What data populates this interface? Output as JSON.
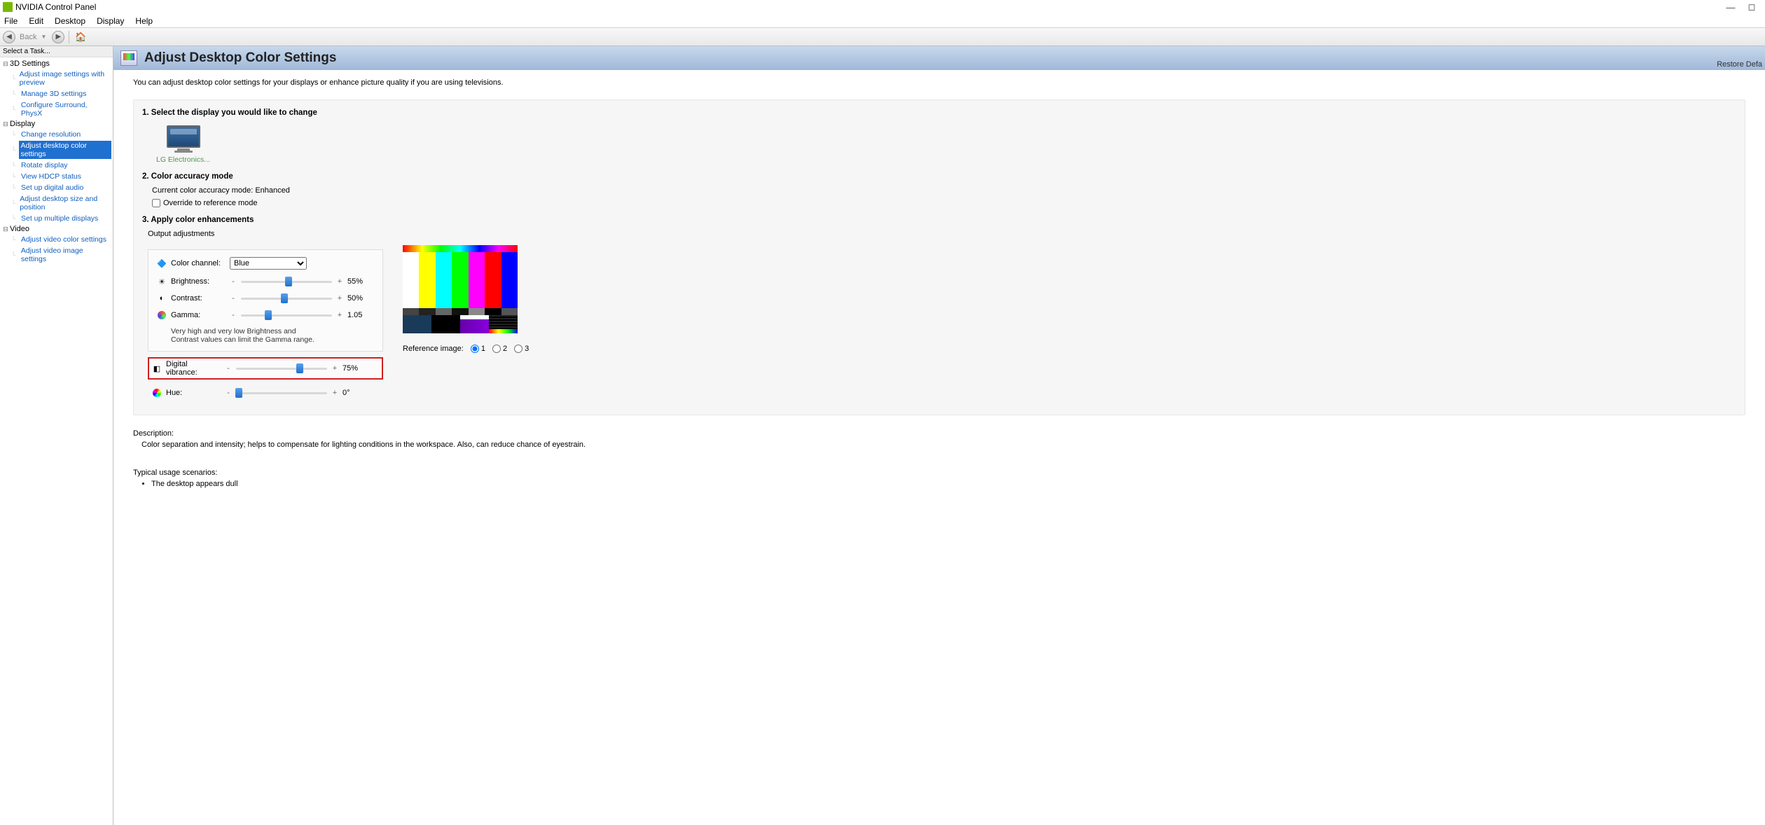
{
  "window": {
    "title": "NVIDIA Control Panel"
  },
  "menu": {
    "file": "File",
    "edit": "Edit",
    "desktop": "Desktop",
    "display": "Display",
    "help": "Help"
  },
  "toolbar": {
    "back": "Back"
  },
  "sidebar": {
    "header": "Select a Task...",
    "groups": [
      {
        "label": "3D Settings",
        "items": [
          {
            "label": "Adjust image settings with preview"
          },
          {
            "label": "Manage 3D settings"
          },
          {
            "label": "Configure Surround, PhysX"
          }
        ]
      },
      {
        "label": "Display",
        "items": [
          {
            "label": "Change resolution"
          },
          {
            "label": "Adjust desktop color settings",
            "selected": true
          },
          {
            "label": "Rotate display"
          },
          {
            "label": "View HDCP status"
          },
          {
            "label": "Set up digital audio"
          },
          {
            "label": "Adjust desktop size and position"
          },
          {
            "label": "Set up multiple displays"
          }
        ]
      },
      {
        "label": "Video",
        "items": [
          {
            "label": "Adjust video color settings"
          },
          {
            "label": "Adjust video image settings"
          }
        ]
      }
    ]
  },
  "page": {
    "title": "Adjust Desktop Color Settings",
    "restore": "Restore Defa",
    "intro": "You can adjust desktop color settings for your displays or enhance picture quality if you are using televisions.",
    "step1": "1. Select the display you would like to change",
    "monitor": "LG Electronics...",
    "step2": "2. Color accuracy mode",
    "accuracy_current": "Current color accuracy mode: Enhanced",
    "accuracy_override": "Override to reference mode",
    "step3": "3. Apply color enhancements",
    "output_adj": "Output adjustments",
    "color_channel_label": "Color channel:",
    "color_channel_value": "Blue",
    "brightness": {
      "label": "Brightness:",
      "value": "55%",
      "pct": 52
    },
    "contrast": {
      "label": "Contrast:",
      "value": "50%",
      "pct": 48
    },
    "gamma": {
      "label": "Gamma:",
      "value": "1.05",
      "pct": 30
    },
    "note": "Very high and very low Brightness and Contrast values can limit the Gamma range.",
    "vibrance": {
      "label": "Digital vibrance:",
      "value": "75%",
      "pct": 70
    },
    "hue": {
      "label": "Hue:",
      "value": "0°",
      "pct": 3
    },
    "refimg_label": "Reference image:",
    "ref": {
      "r1": "1",
      "r2": "2",
      "r3": "3"
    },
    "desc_hdr": "Description:",
    "desc_txt": "Color separation and intensity; helps to compensate for lighting conditions in the workspace. Also, can reduce chance of eyestrain.",
    "usage_hdr": "Typical usage scenarios:",
    "usage_item1": "The desktop appears dull"
  }
}
